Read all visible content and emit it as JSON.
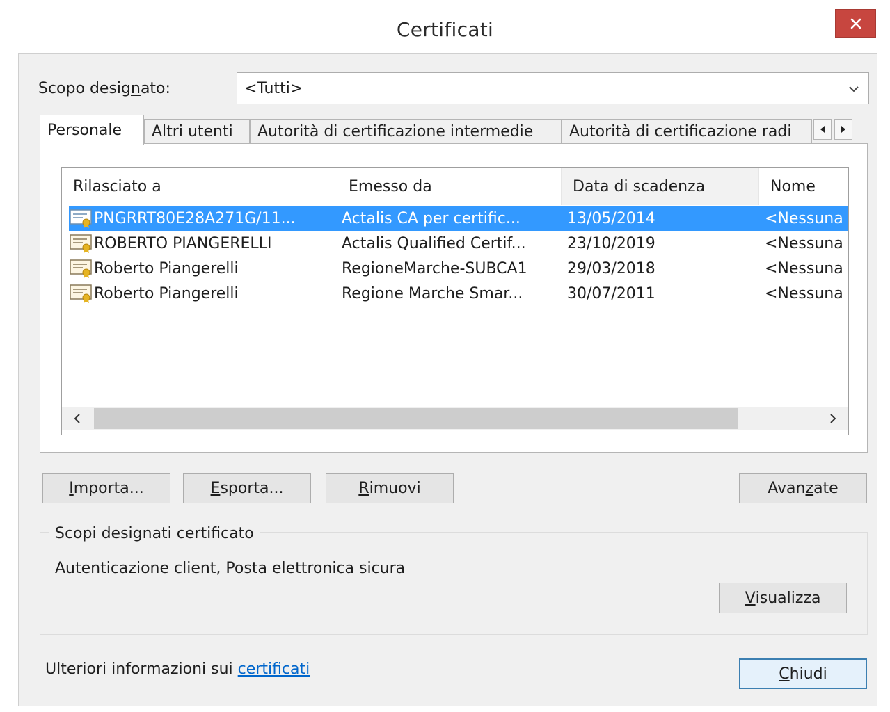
{
  "window": {
    "title": "Certificati",
    "close_icon": "close-icon"
  },
  "scope": {
    "label_before": "Scopo desig",
    "label_mnemonic": "n",
    "label_after": "ato:",
    "selected": "<Tutti>"
  },
  "tabs": [
    {
      "label": "Personale",
      "active": true
    },
    {
      "label": "Altri utenti",
      "active": false
    },
    {
      "label": "Autorità di certificazione intermedie",
      "active": false
    },
    {
      "label": "Autorità di certificazione radi",
      "active": false
    }
  ],
  "columns": [
    "Rilasciato a",
    "Emesso da",
    "Data di scadenza",
    "Nome"
  ],
  "rows": [
    {
      "issued_to": "PNGRRT80E28A271G/11...",
      "issued_by": "Actalis CA per certific...",
      "expiry": "13/05/2014",
      "name": "<Nessuna",
      "selected": true
    },
    {
      "issued_to": "ROBERTO PIANGERELLI",
      "issued_by": "Actalis Qualified Certif...",
      "expiry": "23/10/2019",
      "name": "<Nessuna",
      "selected": false
    },
    {
      "issued_to": "Roberto Piangerelli",
      "issued_by": "RegioneMarche-SUBCA1",
      "expiry": "29/03/2018",
      "name": "<Nessuna",
      "selected": false
    },
    {
      "issued_to": "Roberto Piangerelli",
      "issued_by": "Regione Marche Smar...",
      "expiry": "30/07/2011",
      "name": "<Nessuna",
      "selected": false
    }
  ],
  "buttons": {
    "import": {
      "mnemonic": "I",
      "rest": "mporta..."
    },
    "export": {
      "mnemonic": "E",
      "rest": "sporta..."
    },
    "remove": {
      "mnemonic": "R",
      "rest": "imuovi"
    },
    "advanced": {
      "before": "Avan",
      "mnemonic": "z",
      "after": "ate"
    },
    "view": {
      "mnemonic": "V",
      "rest": "isualizza"
    },
    "close": {
      "mnemonic": "C",
      "rest": "hiudi"
    }
  },
  "purposes": {
    "title": "Scopi designati certificato",
    "text": "Autenticazione client, Posta elettronica sicura"
  },
  "footer": {
    "text": "Ulteriori informazioni sui ",
    "link": "certificati"
  },
  "colors": {
    "selection": "#3399ff",
    "close_button": "#c7463f",
    "link": "#0066cc"
  }
}
